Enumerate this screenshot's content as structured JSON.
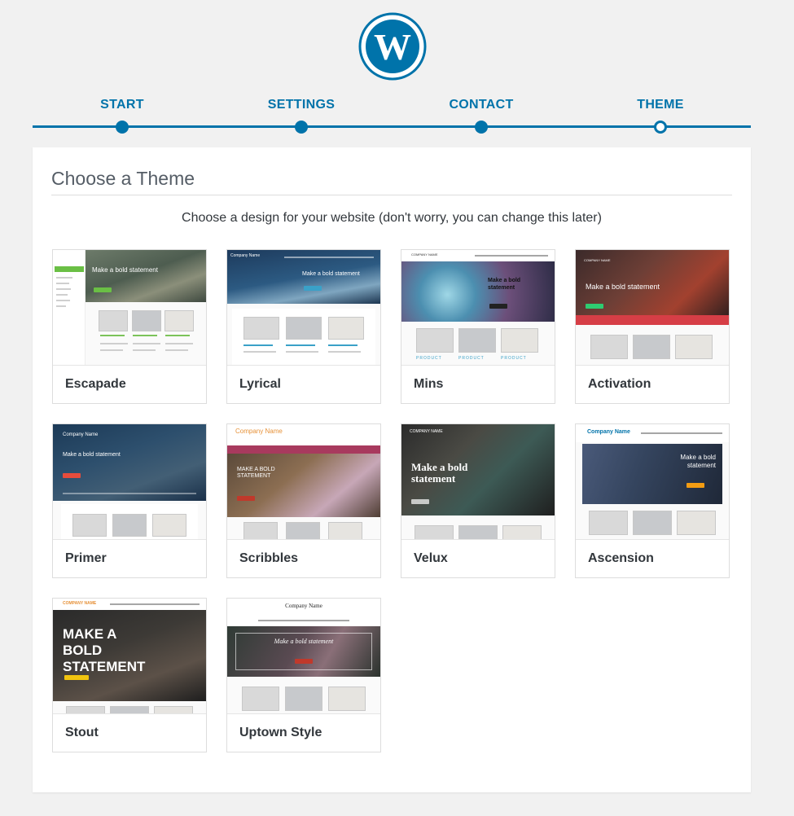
{
  "brand": {
    "logo_icon": "wordpress-logo-icon",
    "color": "#0073aa"
  },
  "steps": [
    {
      "label": "START",
      "state": "done"
    },
    {
      "label": "SETTINGS",
      "state": "done"
    },
    {
      "label": "CONTACT",
      "state": "done"
    },
    {
      "label": "THEME",
      "state": "current"
    }
  ],
  "panel": {
    "title": "Choose a Theme",
    "subtitle": "Choose a design for your website (don't worry, you can change this later)"
  },
  "themes": [
    {
      "name": "Escapade"
    },
    {
      "name": "Lyrical"
    },
    {
      "name": "Mins"
    },
    {
      "name": "Activation"
    },
    {
      "name": "Primer"
    },
    {
      "name": "Scribbles"
    },
    {
      "name": "Velux"
    },
    {
      "name": "Ascension"
    },
    {
      "name": "Stout"
    },
    {
      "name": "Uptown Style"
    }
  ],
  "thumb_text": {
    "make_bold": "Make a bold statement",
    "make_bold_upper": "MAKE A BOLD STATEMENT",
    "company": "Company Name",
    "company_upper": "COMPANY NAME",
    "product": "PRODUCT"
  }
}
